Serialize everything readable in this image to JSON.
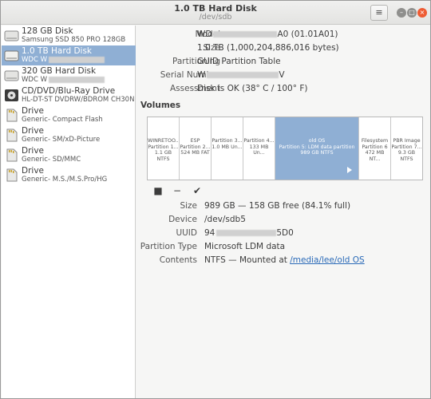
{
  "window": {
    "title": "1.0 TB Hard Disk",
    "subtitle": "/dev/sdb",
    "menu_icon": "hamburger-icon",
    "controls": {
      "minimize": "–",
      "maximize": "□",
      "close": "×"
    }
  },
  "sidebar": {
    "items": [
      {
        "name": "128 GB Disk",
        "sub": "Samsung SSD 850 PRO 128GB",
        "icon": "hard-disk-icon"
      },
      {
        "name": "1.0 TB Hard Disk",
        "sub": "WDC W",
        "icon": "hard-disk-icon",
        "selected": true
      },
      {
        "name": "320 GB Hard Disk",
        "sub": "WDC W",
        "icon": "hard-disk-icon"
      },
      {
        "name": "CD/DVD/Blu-Ray Drive",
        "sub": "HL-DT-ST DVDRW/BDROM CH30N",
        "icon": "optical-drive-icon"
      },
      {
        "name": "Drive",
        "sub": "Generic- Compact Flash",
        "icon": "card-reader-icon"
      },
      {
        "name": "Drive",
        "sub": "Generic- SM/xD-Picture",
        "icon": "card-reader-icon"
      },
      {
        "name": "Drive",
        "sub": "Generic- SD/MMC",
        "icon": "card-reader-icon"
      },
      {
        "name": "Drive",
        "sub": "Generic- M.S./M.S.Pro/HG",
        "icon": "card-reader-icon"
      }
    ]
  },
  "disk": {
    "model_label": "Model",
    "model_value_start": "WD",
    "model_value_end": "A0 (01.01A01)",
    "size_label": "Size",
    "size_value": "1.0 TB (1,000,204,886,016 bytes)",
    "partitioning_label": "Partitioning",
    "partitioning_value": "GUID Partition Table",
    "serial_label": "Serial Number",
    "serial_value_start": "W",
    "serial_value_end": "V",
    "assessment_label": "Assessment",
    "assessment_value": "Disk is OK (38° C / 100° F)"
  },
  "volumes": {
    "heading": "Volumes",
    "partitions": [
      {
        "l1": "WINRETOO...",
        "l2": "Partition 1...",
        "l3": "1.1 GB NTFS"
      },
      {
        "l1": "ESP",
        "l2": "Partition 2...",
        "l3": "524 MB FAT"
      },
      {
        "l1": "Partition 3...",
        "l2": "1.0 MB Un...",
        "l3": ""
      },
      {
        "l1": "Partition 4...",
        "l2": "133 MB Un...",
        "l3": ""
      },
      {
        "l1": "old OS",
        "l2": "Partition 5: LDM data partition",
        "l3": "989 GB NTFS",
        "selected": true
      },
      {
        "l1": "Filesystem",
        "l2": "Partition 6",
        "l3": "472 MB NT..."
      },
      {
        "l1": "PBR Image",
        "l2": "Partition 7...",
        "l3": "9.3 GB NTFS"
      }
    ],
    "toolbar": {
      "stop_icon": "■",
      "remove_icon": "−",
      "check_icon": "✔"
    }
  },
  "partition": {
    "size_label": "Size",
    "size_value": "989 GB — 158 GB free (84.1% full)",
    "device_label": "Device",
    "device_value": "/dev/sdb5",
    "uuid_label": "UUID",
    "uuid_value_start": "94",
    "uuid_value_end": "5D0",
    "type_label": "Partition Type",
    "type_value": "Microsoft LDM data",
    "contents_label": "Contents",
    "contents_value": "NTFS — Mounted at",
    "contents_link": "/media/lee/old OS"
  }
}
